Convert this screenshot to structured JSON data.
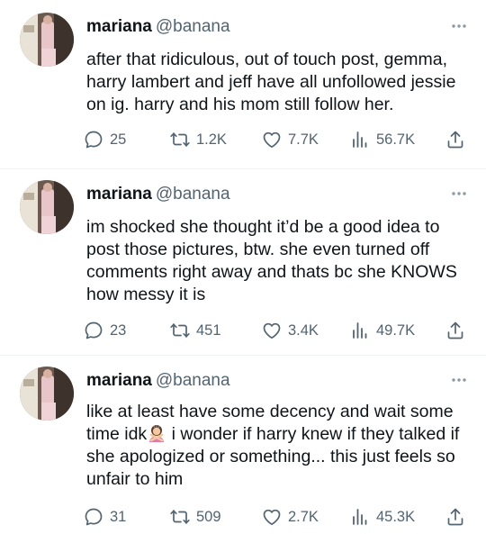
{
  "tweets": [
    {
      "name": "mariana",
      "handle": "@banana",
      "text": "after that ridiculous, out of touch post, gemma, harry lambert and jeff have all unfollowed jessie on ig. harry and his mom still follow her.",
      "text_after_emoji": "",
      "replies": "25",
      "retweets": "1.2K",
      "likes": "7.7K",
      "views": "56.7K"
    },
    {
      "name": "mariana",
      "handle": "@banana",
      "text": "im shocked she thought it’d be a good idea to post those pictures, btw. she even turned off comments right away and thats bc she KNOWS how messy it is",
      "text_after_emoji": "",
      "replies": "23",
      "retweets": "451",
      "likes": "3.4K",
      "views": "49.7K"
    },
    {
      "name": "mariana",
      "handle": "@banana",
      "text": "like at least have some decency and wait some time idk",
      "emoji": "woman-gesturing-no-emoji",
      "text_after_emoji": " i wonder if harry knew if they talked if she apologized or something... this just feels so unfair to him",
      "replies": "31",
      "retweets": "509",
      "likes": "2.7K",
      "views": "45.3K"
    }
  ],
  "colors": {
    "text": "#0f1419",
    "secondary": "#536471",
    "divider": "#eff3f4",
    "background": "#ffffff"
  },
  "icons": [
    "avatar",
    "more-icon",
    "reply-icon",
    "retweet-icon",
    "like-icon",
    "views-icon",
    "share-icon"
  ]
}
